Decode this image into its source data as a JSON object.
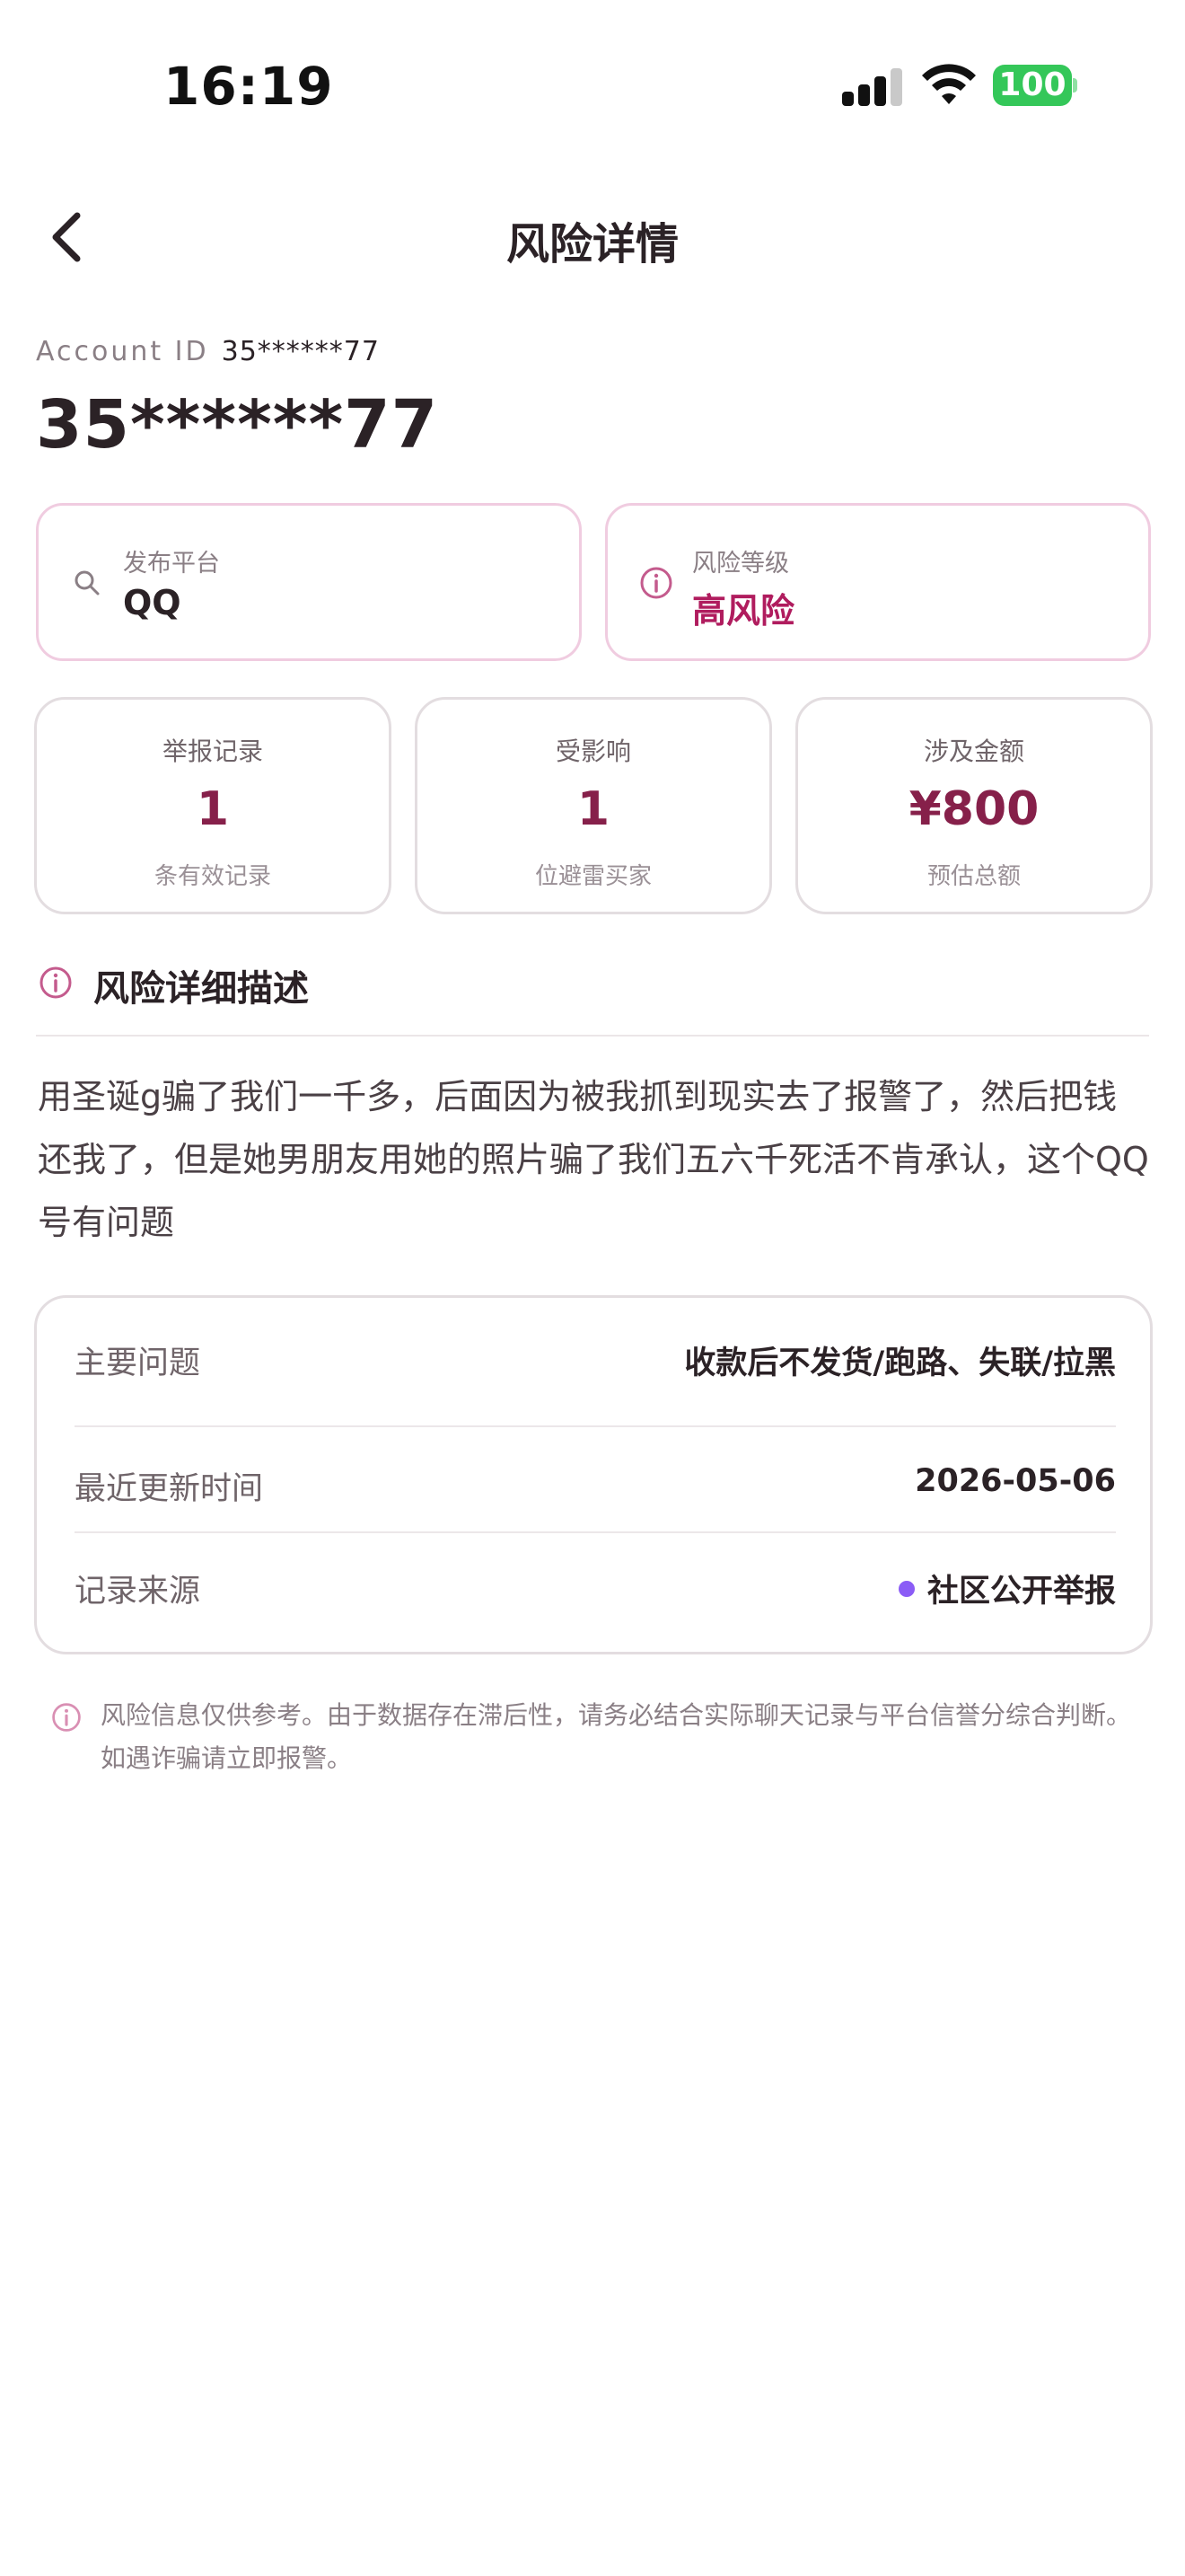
{
  "status_bar": {
    "time": "16:19",
    "battery": "100"
  },
  "nav": {
    "title": "风险详情"
  },
  "account": {
    "id_label": "Account ID",
    "id_value": "35******77",
    "display": "35******77"
  },
  "info_cards": [
    {
      "label": "发布平台",
      "value": "QQ",
      "icon": "search-icon"
    },
    {
      "label": "风险等级",
      "value": "高风险",
      "icon": "info-icon",
      "color": "#b01c5e"
    }
  ],
  "stats": [
    {
      "label": "举报记录",
      "value": "1",
      "sub": "条有效记录"
    },
    {
      "label": "受影响",
      "value": "1",
      "sub": "位避雷买家"
    },
    {
      "label": "涉及金额",
      "value": "¥800",
      "sub": "预估总额"
    }
  ],
  "description": {
    "title": "风险详细描述",
    "text": "用圣诞g骗了我们一千多，后面因为被我抓到现实去了报警了，然后把钱还我了，但是她男朋友用她的照片骗了我们五六千死活不肯承认，这个QQ号有问题"
  },
  "details": [
    {
      "label": "主要问题",
      "value": "收款后不发货/跑路、失联/拉黑"
    },
    {
      "label": "最近更新时间",
      "value": "2026-05-06"
    },
    {
      "label": "记录来源",
      "value": "社区公开举报",
      "dot_color": "#8b5cf6"
    }
  ],
  "disclaimer": "风险信息仅供参考。由于数据存在滞后性，请务必结合实际聊天记录与平台信誉分综合判断。如遇诈骗请立即报警。",
  "colors": {
    "accent": "#86204a",
    "danger": "#b01c5e",
    "card_border_pink": "#f0cce0",
    "source_dot": "#8b5cf6"
  }
}
